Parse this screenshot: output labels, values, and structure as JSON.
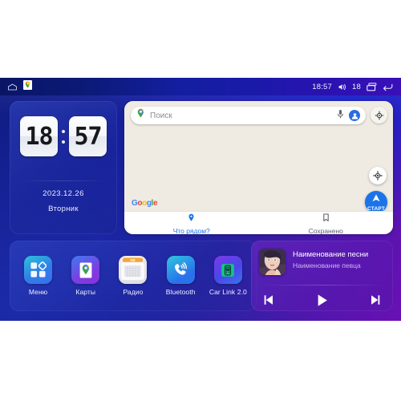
{
  "statusbar": {
    "home_icon": "home-outline-icon",
    "maps_notification_icon": "google-maps-icon",
    "time": "18:57",
    "volume_icon": "volume-icon",
    "volume_level": "18",
    "recents_icon": "recent-apps-icon",
    "back_icon": "back-arrow-icon"
  },
  "clock_widget": {
    "hours": "18",
    "minutes": "57",
    "date": "2023.12.26",
    "weekday": "Вторник"
  },
  "map_widget": {
    "search": {
      "placeholder": "Поиск",
      "pin_icon": "maps-pin-icon",
      "mic_icon": "microphone-icon",
      "avatar_icon": "account-avatar-icon"
    },
    "layers_icon": "map-layers-icon",
    "locate_icon": "my-location-icon",
    "start_button": {
      "label": "СТАРТ",
      "icon": "navigation-arrow-icon"
    },
    "brand": "Google",
    "brand_letters": [
      "G",
      "o",
      "o",
      "g",
      "l",
      "e"
    ],
    "tabs": [
      {
        "label": "Что рядом?",
        "icon": "location-pin-icon",
        "active": true
      },
      {
        "label": "Сохранено",
        "icon": "bookmark-icon",
        "active": false
      }
    ]
  },
  "dock": {
    "apps": [
      {
        "label": "Меню",
        "icon": "apps-grid-icon"
      },
      {
        "label": "Карты",
        "icon": "google-maps-icon"
      },
      {
        "label": "Радио",
        "icon": "radio-icon",
        "badge": "FM"
      },
      {
        "label": "Bluetooth",
        "icon": "bluetooth-phone-icon"
      },
      {
        "label": "Car Link 2.0",
        "icon": "car-link-icon"
      }
    ]
  },
  "music_widget": {
    "album_art": "album-art-thumbnail",
    "title": "Наименование песни",
    "artist": "Наименование певца",
    "controls": [
      {
        "name": "previous-track-button",
        "icon": "skip-previous-icon"
      },
      {
        "name": "play-button",
        "icon": "play-icon"
      },
      {
        "name": "next-track-button",
        "icon": "skip-next-icon"
      }
    ]
  },
  "colors": {
    "accent_blue": "#1a73e8",
    "wallpaper_start": "#101d84",
    "wallpaper_end": "#6910b4",
    "map_surface": "#efebe3"
  }
}
